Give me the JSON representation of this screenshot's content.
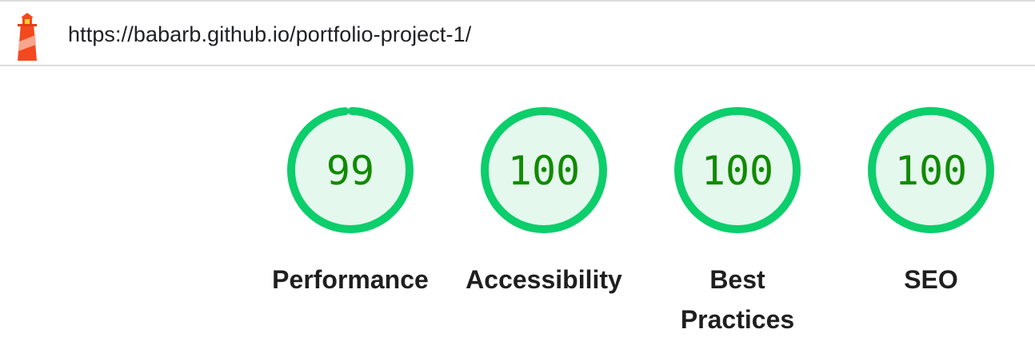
{
  "header": {
    "url": "https://babarb.github.io/portfolio-project-1/",
    "logo_icon": "lighthouse-icon"
  },
  "colors": {
    "pass_ring": "#0cce6b",
    "pass_fill": "#e5f8ee",
    "pass_text": "#118a00",
    "label_text": "#1f1f1f"
  },
  "gauges": [
    {
      "label": "Performance",
      "score": "99",
      "value": 0.99
    },
    {
      "label": "Accessibility",
      "score": "100",
      "value": 1.0
    },
    {
      "label": "Best Practices",
      "score": "100",
      "value": 1.0
    },
    {
      "label": "SEO",
      "score": "100",
      "value": 1.0
    }
  ]
}
